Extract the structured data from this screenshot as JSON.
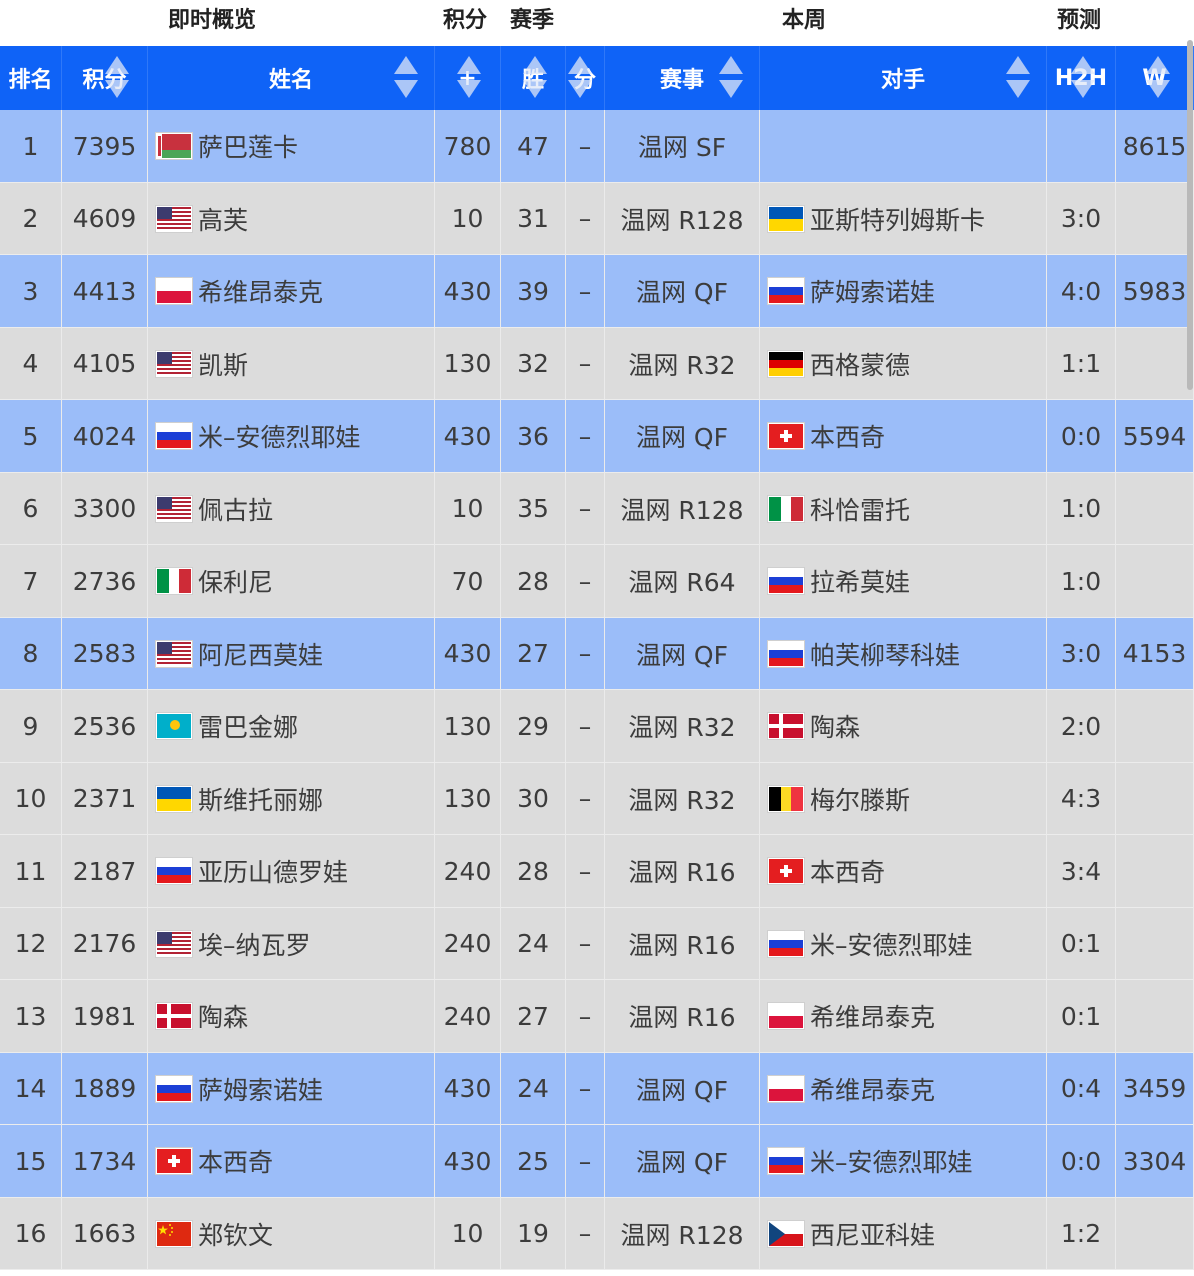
{
  "group_headers": {
    "summary": "即时概览",
    "points": "积分",
    "season": "赛季",
    "this_week": "本周",
    "prediction": "预测"
  },
  "columns": {
    "rank": "排名",
    "points": "积分",
    "name": "姓名",
    "plus": "+",
    "wins": "胜",
    "score": "分",
    "event": "赛事",
    "opponent": "对手",
    "h2h": "H2H",
    "w": "W"
  },
  "colors": {
    "header_blue": "#0f63f7",
    "row_blue": "#9bbdf9",
    "row_gray": "#dcdcdc"
  },
  "rows": [
    {
      "rank": "1",
      "points": "7395",
      "flag": "belarus",
      "name": "萨巴莲卡",
      "plus": "780",
      "wins": "47",
      "score": "–",
      "event": "温网 SF",
      "opp_flag": "",
      "opponent": "",
      "h2h": "",
      "w": "8615",
      "hl": true
    },
    {
      "rank": "2",
      "points": "4609",
      "flag": "usa",
      "name": "高芙",
      "plus": "10",
      "wins": "31",
      "score": "–",
      "event": "温网 R128",
      "opp_flag": "ukraine",
      "opponent": "亚斯特列姆斯卡",
      "h2h": "3:0",
      "w": "",
      "hl": false
    },
    {
      "rank": "3",
      "points": "4413",
      "flag": "poland",
      "name": "希维昂泰克",
      "plus": "430",
      "wins": "39",
      "score": "–",
      "event": "温网 QF",
      "opp_flag": "russia",
      "opponent": "萨姆索诺娃",
      "h2h": "4:0",
      "w": "5983",
      "hl": true
    },
    {
      "rank": "4",
      "points": "4105",
      "flag": "usa",
      "name": "凯斯",
      "plus": "130",
      "wins": "32",
      "score": "–",
      "event": "温网 R32",
      "opp_flag": "germany",
      "opponent": "西格蒙德",
      "h2h": "1:1",
      "w": "",
      "hl": false
    },
    {
      "rank": "5",
      "points": "4024",
      "flag": "russia",
      "name": "米–安德烈耶娃",
      "plus": "430",
      "wins": "36",
      "score": "–",
      "event": "温网 QF",
      "opp_flag": "switzerland",
      "opponent": "本西奇",
      "h2h": "0:0",
      "w": "5594",
      "hl": true
    },
    {
      "rank": "6",
      "points": "3300",
      "flag": "usa",
      "name": "佩古拉",
      "plus": "10",
      "wins": "35",
      "score": "–",
      "event": "温网 R128",
      "opp_flag": "italy",
      "opponent": "科恰雷托",
      "h2h": "1:0",
      "w": "",
      "hl": false
    },
    {
      "rank": "7",
      "points": "2736",
      "flag": "italy",
      "name": "保利尼",
      "plus": "70",
      "wins": "28",
      "score": "–",
      "event": "温网 R64",
      "opp_flag": "russia",
      "opponent": "拉希莫娃",
      "h2h": "1:0",
      "w": "",
      "hl": false
    },
    {
      "rank": "8",
      "points": "2583",
      "flag": "usa",
      "name": "阿尼西莫娃",
      "plus": "430",
      "wins": "27",
      "score": "–",
      "event": "温网 QF",
      "opp_flag": "russia",
      "opponent": "帕芙柳琴科娃",
      "h2h": "3:0",
      "w": "4153",
      "hl": true
    },
    {
      "rank": "9",
      "points": "2536",
      "flag": "kazakhstan",
      "name": "雷巴金娜",
      "plus": "130",
      "wins": "29",
      "score": "–",
      "event": "温网 R32",
      "opp_flag": "denmark",
      "opponent": "陶森",
      "h2h": "2:0",
      "w": "",
      "hl": false
    },
    {
      "rank": "10",
      "points": "2371",
      "flag": "ukraine",
      "name": "斯维托丽娜",
      "plus": "130",
      "wins": "30",
      "score": "–",
      "event": "温网 R32",
      "opp_flag": "belgium",
      "opponent": "梅尔滕斯",
      "h2h": "4:3",
      "w": "",
      "hl": false
    },
    {
      "rank": "11",
      "points": "2187",
      "flag": "russia",
      "name": "亚历山德罗娃",
      "plus": "240",
      "wins": "28",
      "score": "–",
      "event": "温网 R16",
      "opp_flag": "switzerland",
      "opponent": "本西奇",
      "h2h": "3:4",
      "w": "",
      "hl": false
    },
    {
      "rank": "12",
      "points": "2176",
      "flag": "usa",
      "name": "埃–纳瓦罗",
      "plus": "240",
      "wins": "24",
      "score": "–",
      "event": "温网 R16",
      "opp_flag": "russia",
      "opponent": "米–安德烈耶娃",
      "h2h": "0:1",
      "w": "",
      "hl": false
    },
    {
      "rank": "13",
      "points": "1981",
      "flag": "denmark",
      "name": "陶森",
      "plus": "240",
      "wins": "27",
      "score": "–",
      "event": "温网 R16",
      "opp_flag": "poland",
      "opponent": "希维昂泰克",
      "h2h": "0:1",
      "w": "",
      "hl": false
    },
    {
      "rank": "14",
      "points": "1889",
      "flag": "russia",
      "name": "萨姆索诺娃",
      "plus": "430",
      "wins": "24",
      "score": "–",
      "event": "温网 QF",
      "opp_flag": "poland",
      "opponent": "希维昂泰克",
      "h2h": "0:4",
      "w": "3459",
      "hl": true
    },
    {
      "rank": "15",
      "points": "1734",
      "flag": "switzerland",
      "name": "本西奇",
      "plus": "430",
      "wins": "25",
      "score": "–",
      "event": "温网 QF",
      "opp_flag": "russia",
      "opponent": "米–安德烈耶娃",
      "h2h": "0:0",
      "w": "3304",
      "hl": true
    },
    {
      "rank": "16",
      "points": "1663",
      "flag": "china",
      "name": "郑钦文",
      "plus": "10",
      "wins": "19",
      "score": "–",
      "event": "温网 R128",
      "opp_flag": "czech",
      "opponent": "西尼亚科娃",
      "h2h": "1:2",
      "w": "",
      "hl": false
    }
  ]
}
